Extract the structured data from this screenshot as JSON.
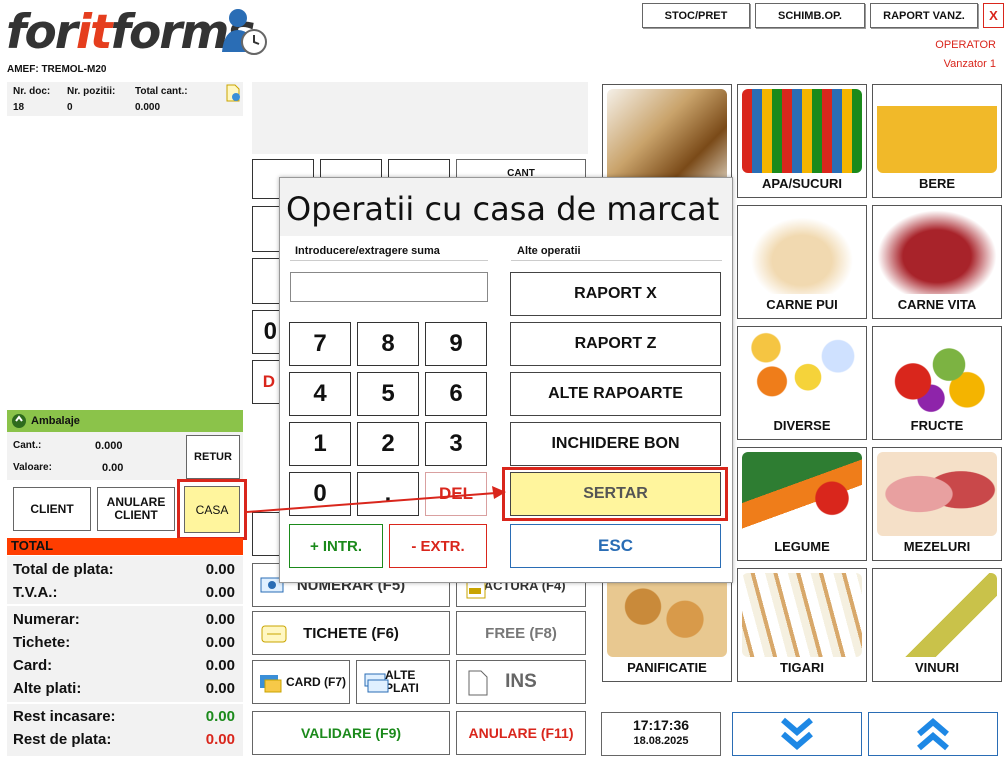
{
  "header": {
    "logo_pre": "for",
    "logo_mid": "it",
    "logo_post": "forms",
    "device": "AMEF: TREMOL-M20",
    "buttons": [
      "STOC/PRET",
      "SCHIMB.OP.",
      "RAPORT VANZ."
    ],
    "close": "X",
    "operator_label": "OPERATOR",
    "operator_name": "Vanzator 1"
  },
  "doc": {
    "col1": "Nr. doc:",
    "col2": "Nr. pozitii:",
    "col3": "Total cant.:",
    "val1": "18",
    "val2": "0",
    "val3": "0.000"
  },
  "ambalaje": {
    "title": "Ambalaje",
    "cant_label": "Cant.:",
    "cant": "0.000",
    "val_label": "Valoare:",
    "val": "0.00",
    "retur": "RETUR"
  },
  "actions": {
    "client": "CLIENT",
    "anulare": "ANULARE CLIENT",
    "casa": "CASA"
  },
  "totals": {
    "header": "TOTAL",
    "rows": [
      {
        "label": "Total de plata:",
        "value": "0.00"
      },
      {
        "label": "T.V.A.:",
        "value": "0.00"
      },
      {
        "label": "Numerar:",
        "value": "0.00"
      },
      {
        "label": "Tichete:",
        "value": "0.00"
      },
      {
        "label": "Card:",
        "value": "0.00"
      },
      {
        "label": "Alte plati:",
        "value": "0.00"
      },
      {
        "label": "Rest incasare:",
        "value": "0.00"
      },
      {
        "label": "Rest de plata:",
        "value": "0.00"
      }
    ]
  },
  "pos": {
    "cant": "CANT",
    "numerar": "NUMERAR (F5)",
    "factura": "FACTURA (F4)",
    "tichete": "TICHETE (F6)",
    "free": "FREE (F8)",
    "card": "CARD (F7)",
    "alte": "ALTE PLATI",
    "ins": "INS",
    "validare": "VALIDARE (F9)",
    "anulare": "ANULARE (F11)",
    "partial_zero": "0",
    "partial_d": "D"
  },
  "dialog": {
    "title": "Operatii cu casa de marcat",
    "left_header": "Introducere/extragere suma",
    "right_header": "Alte operatii",
    "keys": [
      "7",
      "8",
      "9",
      "4",
      "5",
      "6",
      "1",
      "2",
      "3",
      "0",
      ".",
      "DEL"
    ],
    "intr": "+ INTR.",
    "extr": "- EXTR.",
    "ops": [
      "RAPORT X",
      "RAPORT Z",
      "ALTE RAPOARTE",
      "INCHIDERE BON",
      "SERTAR"
    ],
    "esc": "ESC"
  },
  "categories": [
    "APA/SUCURI",
    "BERE",
    "CARNE PUI",
    "CARNE VITA",
    "DIVERSE",
    "FRUCTE",
    "LEGUME",
    "MEZELURI",
    "PANIFICATIE",
    "TIGARI",
    "VINURI"
  ],
  "clock": {
    "time": "17:17:36",
    "date": "18.08.2025"
  },
  "colors": {
    "accent_red": "#d9261c",
    "total_bar": "#ff3d00",
    "amb_bar": "#8bc34a",
    "sertar_bg": "#fff59d"
  }
}
